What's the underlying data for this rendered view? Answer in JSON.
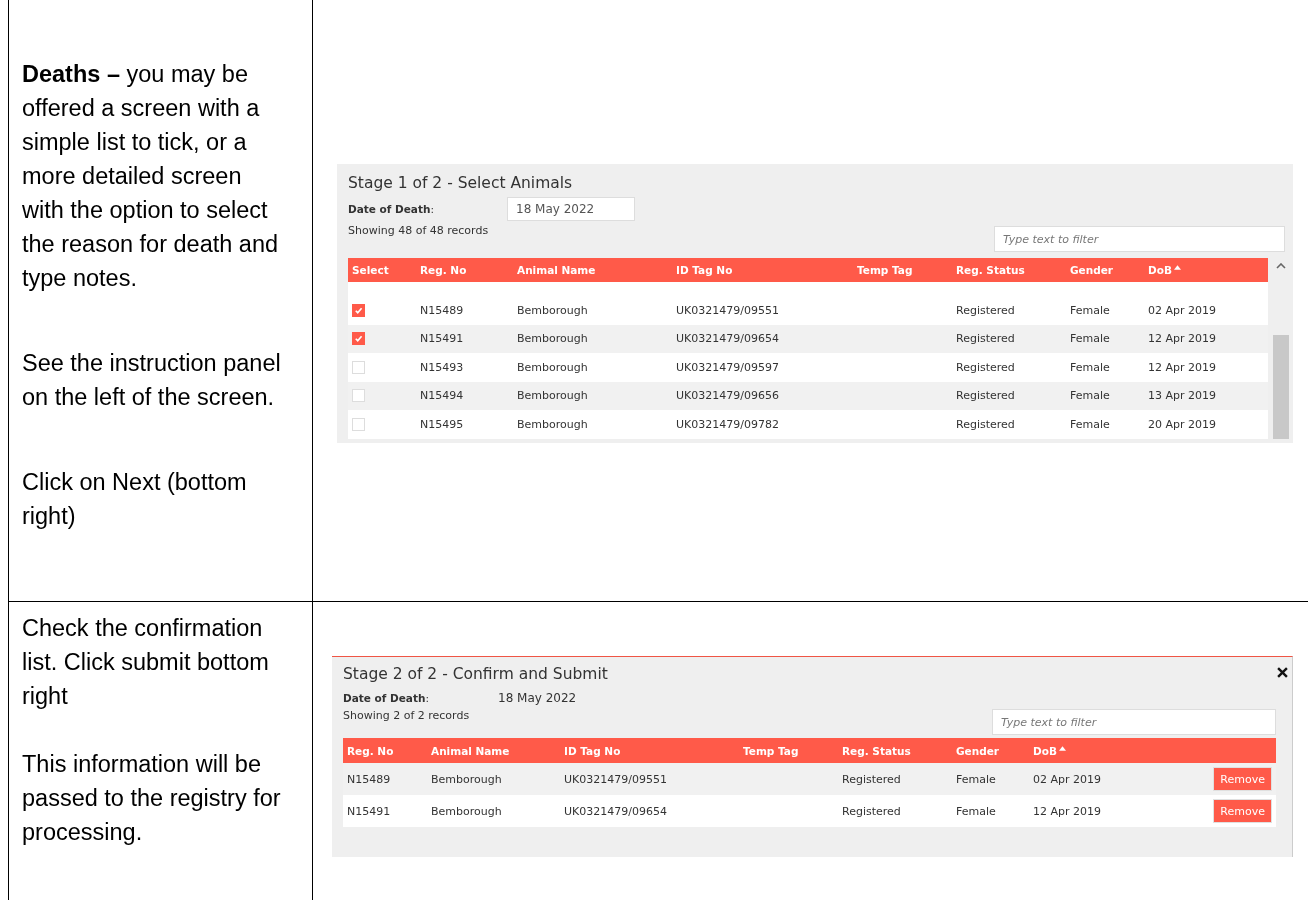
{
  "rows": [
    {
      "paragraphs": [
        "**Deaths –** you may be offered a screen with a simple list to tick, or a more detailed screen with the option to select the reason for death and type notes.",
        "See the instruction panel on the left of the screen.",
        "Click on Next (bottom right)"
      ],
      "screen": {
        "kind": "select",
        "title": "Stage 1 of 2 - Select Animals",
        "date_label": "**Date of Death**:",
        "date_value": "18 May 2022",
        "records": "Showing 48 of 48 records",
        "filter_placeholder": "Type text to filter",
        "columns": [
          {
            "label": "Select",
            "sorted": false
          },
          {
            "label": "Reg. No",
            "sorted": false
          },
          {
            "label": "Animal Name",
            "sorted": false
          },
          {
            "label": "ID Tag No",
            "sorted": false
          },
          {
            "label": "Temp Tag",
            "sorted": false
          },
          {
            "label": "Reg. Status",
            "sorted": false
          },
          {
            "label": "Gender",
            "sorted": false
          },
          {
            "label": "DoB",
            "sorted": true
          }
        ],
        "rows": [
          {
            "checked": true,
            "cells": [
              "",
              "N15489",
              "Bemborough",
              "UK0321479/09551",
              "",
              "Registered",
              "Female",
              "02 Apr 2019"
            ]
          },
          {
            "checked": true,
            "cells": [
              "",
              "N15491",
              "Bemborough",
              "UK0321479/09654",
              "",
              "Registered",
              "Female",
              "12 Apr 2019"
            ]
          },
          {
            "checked": false,
            "cells": [
              "",
              "N15493",
              "Bemborough",
              "UK0321479/09597",
              "",
              "Registered",
              "Female",
              "12 Apr 2019"
            ]
          },
          {
            "checked": false,
            "cells": [
              "",
              "N15494",
              "Bemborough",
              "UK0321479/09656",
              "",
              "Registered",
              "Female",
              "13 Apr 2019"
            ]
          },
          {
            "checked": false,
            "cells": [
              "",
              "N15495",
              "Bemborough",
              "UK0321479/09782",
              "",
              "Registered",
              "Female",
              "20 Apr 2019"
            ]
          }
        ]
      }
    },
    {
      "paragraphs": [
        "Check the confirmation list. Click submit bottom right",
        "This information will be passed to the registry for processing."
      ],
      "screen": {
        "kind": "confirm",
        "title": "Stage 2 of 2 - Confirm and Submit",
        "date_label": "**Date of Death**:",
        "date_value": "18 May 2022",
        "records": "Showing 2 of 2 records",
        "filter_placeholder": "Type text to filter",
        "columns": [
          {
            "label": "Reg. No",
            "sorted": false
          },
          {
            "label": "Animal Name",
            "sorted": false
          },
          {
            "label": "ID Tag No",
            "sorted": false
          },
          {
            "label": "Temp Tag",
            "sorted": false
          },
          {
            "label": "Reg. Status",
            "sorted": false
          },
          {
            "label": "Gender",
            "sorted": false
          },
          {
            "label": "DoB",
            "sorted": true
          }
        ],
        "rows": [
          {
            "action": "Remove",
            "cells": [
              "N15489",
              "Bemborough",
              "UK0321479/09551",
              "",
              "Registered",
              "Female",
              "02 Apr 2019"
            ]
          },
          {
            "action": "Remove",
            "cells": [
              "N15491",
              "Bemborough",
              "UK0321479/09654",
              "",
              "Registered",
              "Female",
              "12 Apr 2019"
            ]
          }
        ]
      }
    }
  ]
}
